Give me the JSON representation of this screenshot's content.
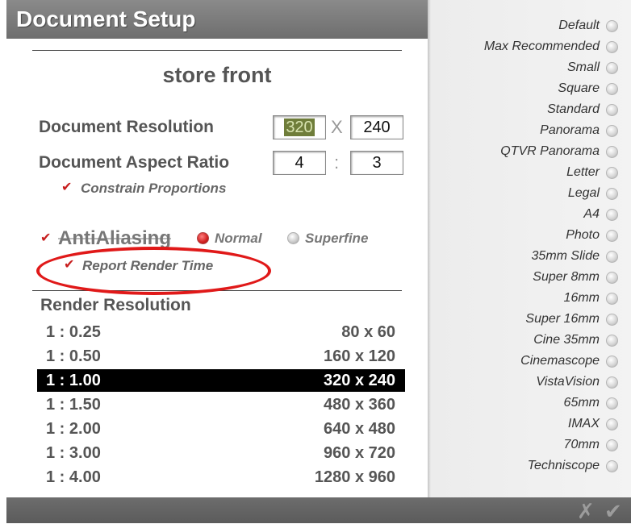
{
  "window": {
    "title": "Document Setup"
  },
  "document": {
    "name": "store front"
  },
  "resolution": {
    "label": "Document Resolution",
    "width": "320",
    "separator": "X",
    "height": "240"
  },
  "aspect": {
    "label": "Document Aspect Ratio",
    "w": "4",
    "separator": ":",
    "h": "3"
  },
  "constrain": {
    "label": "Constrain Proportions",
    "checked": true
  },
  "antialiasing": {
    "label": "AntiAliasing",
    "checked": true,
    "options": [
      {
        "label": "Normal",
        "selected": true
      },
      {
        "label": "Superfine",
        "selected": false
      }
    ]
  },
  "report_render_time": {
    "label": "Report Render Time",
    "checked": true
  },
  "render_resolution": {
    "title": "Render Resolution",
    "rows": [
      {
        "ratio": "1 : 0.25",
        "dims": "80 x 60",
        "selected": false
      },
      {
        "ratio": "1 : 0.50",
        "dims": "160 x 120",
        "selected": false
      },
      {
        "ratio": "1 : 1.00",
        "dims": "320 x 240",
        "selected": true
      },
      {
        "ratio": "1 : 1.50",
        "dims": "480 x 360",
        "selected": false
      },
      {
        "ratio": "1 : 2.00",
        "dims": "640 x 480",
        "selected": false
      },
      {
        "ratio": "1 : 3.00",
        "dims": "960 x 720",
        "selected": false
      },
      {
        "ratio": "1 : 4.00",
        "dims": "1280 x 960",
        "selected": false
      }
    ]
  },
  "presets": [
    "Default",
    "Max Recommended",
    "Small",
    "Square",
    "Standard",
    "Panorama",
    "QTVR Panorama",
    "Letter",
    "Legal",
    "A4",
    "Photo",
    "35mm Slide",
    "Super 8mm",
    "16mm",
    "Super 16mm",
    "Cine 35mm",
    "Cinemascope",
    "VistaVision",
    "65mm",
    "IMAX",
    "70mm",
    "Techniscope"
  ],
  "footer": {
    "cancel_icon": "x-icon",
    "ok_icon": "checkmark-icon"
  },
  "colors": {
    "accent": "#c71d1d",
    "selection": "#000000",
    "titlebar": "#7a7a7a"
  }
}
